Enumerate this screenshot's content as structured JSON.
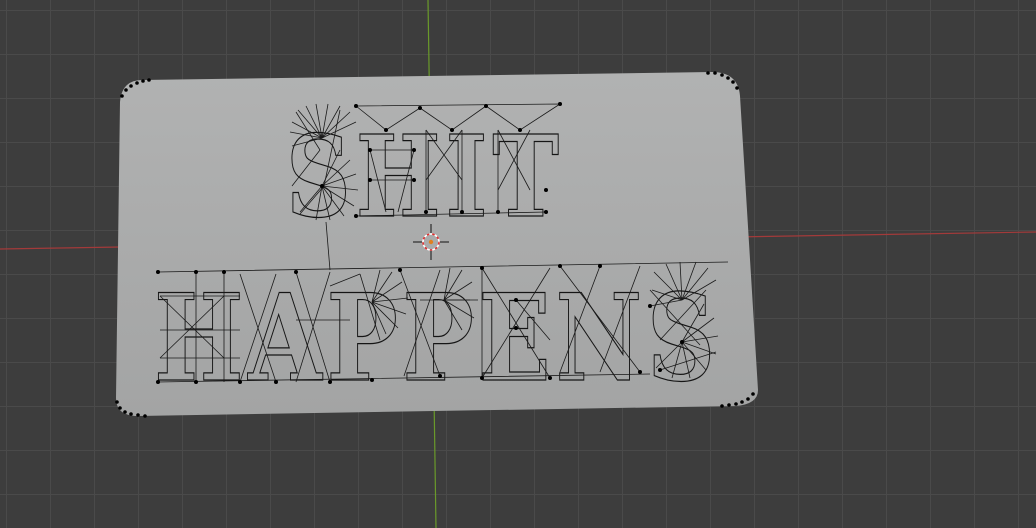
{
  "viewport": {
    "background": "#3d3d3d",
    "grid_color": "#4a4a4a",
    "x_axis_color": "#a33a3a",
    "y_axis_color": "#6a9a2a"
  },
  "mesh": {
    "line1": "SHIT",
    "line2": "HAPPENS",
    "plate_color": "#a9aaaa",
    "vertex_color": "#000000"
  },
  "cursor": {
    "icon": "3d-cursor-icon",
    "color": "#e03030"
  }
}
